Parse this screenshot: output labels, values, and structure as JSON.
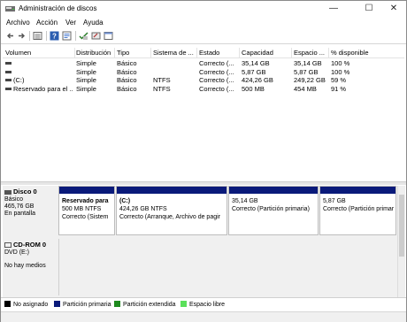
{
  "window": {
    "title": "Administración de discos",
    "minimize_glyph": "—",
    "maximize_glyph": "☐",
    "close_glyph": "✕"
  },
  "menu": [
    "Archivo",
    "Acción",
    "Ver",
    "Ayuda"
  ],
  "toolbar": [
    "back-arrow-icon",
    "forward-arrow-icon",
    "list-view-icon",
    "help-icon",
    "properties-icon",
    "check-icon",
    "wizard-icon",
    "console-icon"
  ],
  "table": {
    "columns": [
      "Volumen",
      "Distribución",
      "Tipo",
      "Sistema de ...",
      "Estado",
      "Capacidad",
      "Espacio ...",
      "% disponible"
    ],
    "rows": [
      [
        "",
        "Simple",
        "Básico",
        "",
        "Correcto (...",
        "35,14 GB",
        "35,14 GB",
        "100 %"
      ],
      [
        "",
        "Simple",
        "Básico",
        "",
        "Correcto (...",
        "5,87 GB",
        "5,87 GB",
        "100 %"
      ],
      [
        "(C:)",
        "Simple",
        "Básico",
        "NTFS",
        "Correcto (...",
        "424,26 GB",
        "249,22 GB",
        "59 %"
      ],
      [
        "Reservado para el ...",
        "Simple",
        "Básico",
        "NTFS",
        "Correcto (...",
        "500 MB",
        "454 MB",
        "91 %"
      ]
    ]
  },
  "disk0": {
    "title": "Disco 0",
    "line1": "Básico",
    "line2": "465,76 GB",
    "line3": "En pantalla",
    "partitions": [
      {
        "name": "Reservado para",
        "l1": "500 MB NTFS",
        "l2": "Correcto (Sistem"
      },
      {
        "name": "(C:)",
        "l1": "424,26 GB NTFS",
        "l2": "Correcto (Arranque, Archivo de pagir"
      },
      {
        "name": "",
        "l1": "35,14 GB",
        "l2": "Correcto (Partición primaria)"
      },
      {
        "name": "",
        "l1": "5,87 GB",
        "l2": "Correcto (Partición primaria)"
      }
    ]
  },
  "cdrom": {
    "title": "CD-ROM 0",
    "line1": "DVD (E:)",
    "line2": "No hay medios"
  },
  "legend": [
    {
      "label": "No asignado",
      "color": "#000000"
    },
    {
      "label": "Partición primaria",
      "color": "#0a1a7a"
    },
    {
      "label": "Partición extendida",
      "color": "#1e8a1e"
    },
    {
      "label": "Espacio libre",
      "color": "#5be05b"
    }
  ]
}
